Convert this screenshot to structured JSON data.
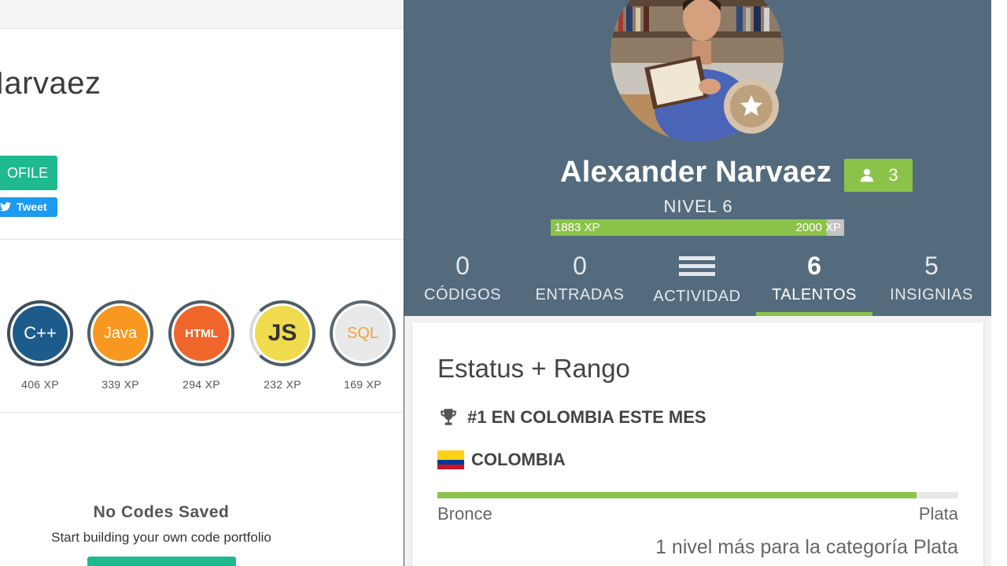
{
  "left_page": {
    "profile_name": "Narvaez",
    "profile_button_label": "OFILE",
    "tweet_label": "Tweet",
    "skills": [
      {
        "label": "C++",
        "xp": "406 XP",
        "color": "#1d5b8a",
        "ring": "#556670"
      },
      {
        "label": "Java",
        "xp": "339 XP",
        "color": "#f89820",
        "ring": "#4f5e66"
      },
      {
        "label": "HTML",
        "xp": "294 XP",
        "color": "#f06529",
        "ring": "#4f5e66"
      },
      {
        "label": "JS",
        "xp": "232 XP",
        "color": "#f0db4f",
        "ring": "#d5d5d5"
      },
      {
        "label": "SQL",
        "xp": "169 XP",
        "color": "#e9e9e9",
        "ring": "#5a6770"
      }
    ],
    "no_codes_title": "No Codes Saved",
    "no_codes_subtitle": "Start building your own code portfolio"
  },
  "panel": {
    "user_name": "Alexander Narvaez",
    "followers_count": "3",
    "level": "NIVEL 6",
    "xp_current": "1883 XP",
    "xp_target": "2000 XP",
    "xp_progress": 0.9415,
    "tabs": [
      {
        "value": "0",
        "label": "CÓDIGOS"
      },
      {
        "value": "0",
        "label": "ENTRADAS"
      },
      {
        "value": "",
        "label": "ACTIVIDAD"
      },
      {
        "value": "6",
        "label": "TALENTOS"
      },
      {
        "value": "5",
        "label": "INSIGNIAS"
      }
    ],
    "active_tab": "TALENTOS",
    "card": {
      "title": "Estatus + Rango",
      "rank": "#1 EN COLOMBIA ESTE MES",
      "country": "COLOMBIA",
      "rank_progress": 0.92,
      "from_label": "Bronce",
      "to_label": "Plata",
      "next_level_text": "1 nivel más para la categoría Plata"
    }
  },
  "colors": {
    "header": "#546b7e",
    "accent_green": "#8bc34a",
    "button_green": "#1eb98e",
    "twitter_blue": "#1d9bf0"
  }
}
